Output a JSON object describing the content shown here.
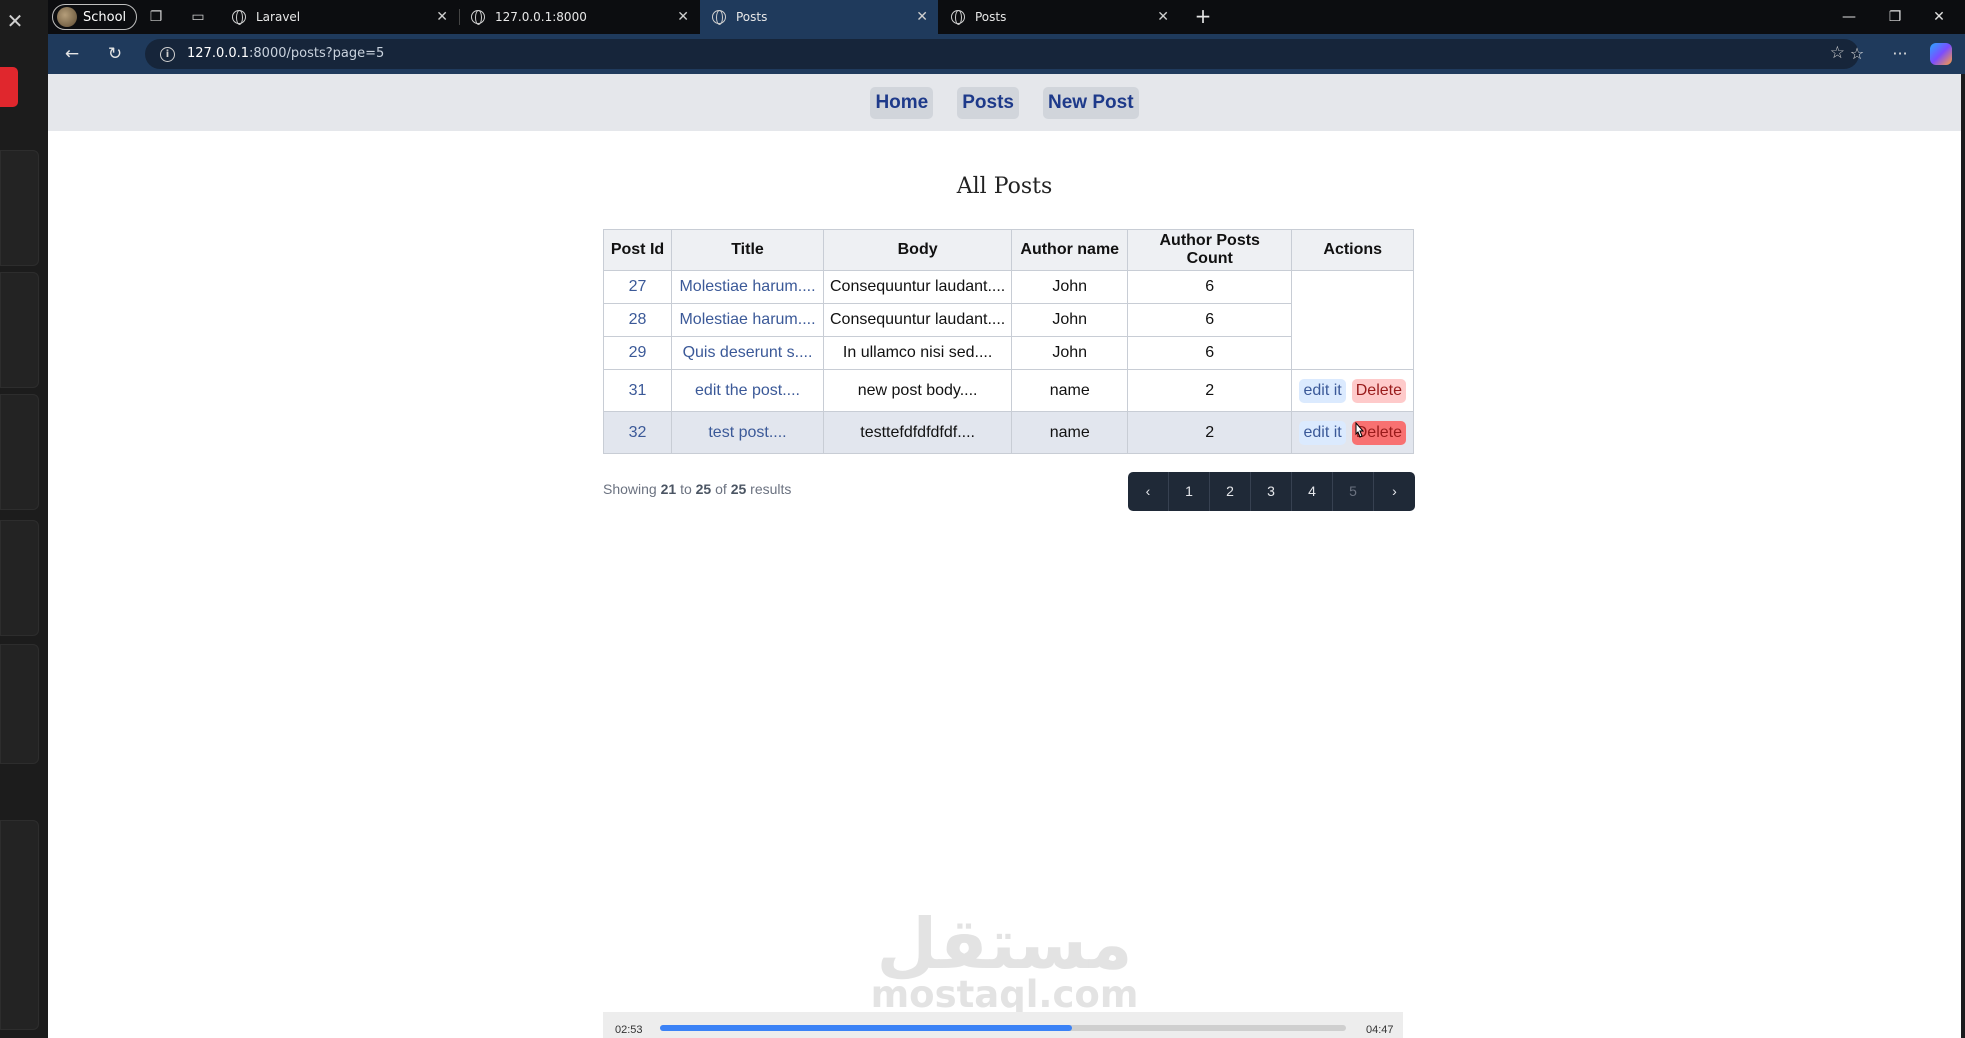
{
  "browser": {
    "profile_name": "School",
    "tabs": [
      {
        "title": "Laravel"
      },
      {
        "title": "127.0.0.1:8000"
      },
      {
        "title": "Posts"
      },
      {
        "title": "Posts"
      }
    ],
    "url_host": "127.0.0.1",
    "url_rest": ":8000/posts?page=5"
  },
  "nav": {
    "home": "Home",
    "posts": "Posts",
    "new_post": "New Post"
  },
  "page_title": "All Posts",
  "table": {
    "headers": {
      "id": "Post Id",
      "title": "Title",
      "body": "Body",
      "author": "Author name",
      "count": "Author Posts Count",
      "actions": "Actions"
    },
    "rows": [
      {
        "id": "27",
        "title": "Molestiae harum....",
        "body": "Consequuntur laudant....",
        "author": "John",
        "count": "6"
      },
      {
        "id": "28",
        "title": "Molestiae harum....",
        "body": "Consequuntur laudant....",
        "author": "John",
        "count": "6"
      },
      {
        "id": "29",
        "title": "Quis deserunt s....",
        "body": "In ullamco nisi sed....",
        "author": "John",
        "count": "6"
      },
      {
        "id": "31",
        "title": "edit the post....",
        "body": "new post body....",
        "author": "name",
        "count": "2",
        "edit": "edit it",
        "delete": "Delete"
      },
      {
        "id": "32",
        "title": "test post....",
        "body": "testtefdfdfdfdf....",
        "author": "name",
        "count": "2",
        "edit": "edit it",
        "delete": "Delete"
      }
    ]
  },
  "pagination": {
    "showing_prefix": "Showing",
    "from": "21",
    "to_word": "to",
    "to": "25",
    "of_word": "of",
    "total": "25",
    "results_word": "results",
    "prev": "‹",
    "pages": [
      "1",
      "2",
      "3",
      "4",
      "5"
    ],
    "current_page": "5",
    "next": "›"
  },
  "watermark": {
    "arabic": "مستقل",
    "latin": "mostaql.com"
  },
  "video": {
    "elapsed": "02:53",
    "total": "04:47",
    "progress": 0.6
  }
}
